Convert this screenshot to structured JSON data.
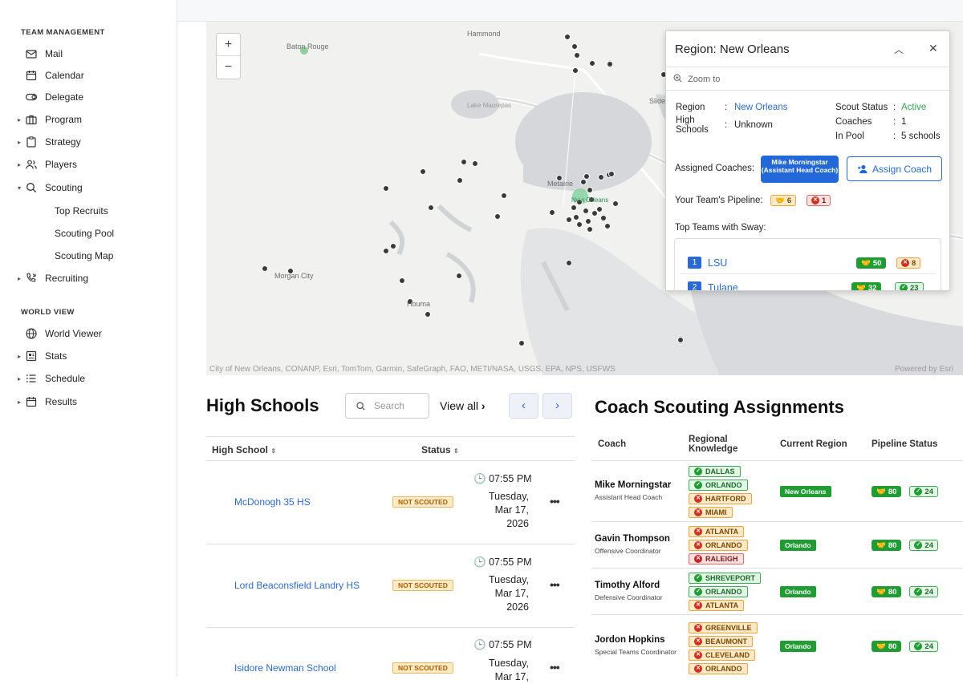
{
  "sidebar": {
    "team_management": "TEAM MANAGEMENT",
    "world_view": "WORLD VIEW",
    "items": [
      {
        "label": "Mail"
      },
      {
        "label": "Calendar"
      },
      {
        "label": "Delegate"
      },
      {
        "label": "Program"
      },
      {
        "label": "Strategy"
      },
      {
        "label": "Players"
      },
      {
        "label": "Scouting"
      },
      {
        "label": "Recruiting"
      },
      {
        "label": "World Viewer"
      },
      {
        "label": "Stats"
      },
      {
        "label": "Schedule"
      },
      {
        "label": "Results"
      }
    ],
    "scouting_sub": [
      "Top Recruits",
      "Scouting Pool",
      "Scouting Map"
    ]
  },
  "map": {
    "zoom_in": "+",
    "zoom_out": "−",
    "places": [
      "Hammond",
      "Baton Rouge",
      "Lake Maurepas",
      "Metairie",
      "New Orleans",
      "Morgan City",
      "Houma",
      "Slidell"
    ],
    "attribution": "City of New Orleans, CONANP, Esri, TomTom, Garmin, SafeGraph, FAO, METI/NASA, USGS, EPA, NPS, USFWS",
    "powered": "Powered by Esri"
  },
  "popup": {
    "title": "Region: New Orleans",
    "zoom_to": "Zoom to",
    "region_label": "Region",
    "region_value": "New Orleans",
    "high_schools_label": "High Schools",
    "high_schools_value": "Unknown",
    "scout_status_label": "Scout Status",
    "scout_status_value": "Active",
    "coaches_label": "Coaches",
    "coaches_value": "1",
    "in_pool_label": "In Pool",
    "in_pool_value": "5 schools",
    "assigned_coaches_label": "Assigned Coaches:",
    "assigned_coach": "Mike Morningstar (Assistant Head Coach)",
    "assign_coach": "Assign Coach",
    "pipeline_label": "Your Team's Pipeline:",
    "pipeline_values": [
      "6",
      "1"
    ],
    "top_teams_label": "Top Teams with Sway:",
    "top_teams": [
      {
        "rank": "1",
        "name": "LSU",
        "a": "50",
        "b": "8"
      },
      {
        "rank": "2",
        "name": "Tulane",
        "a": "32",
        "b": "23"
      }
    ]
  },
  "high_schools": {
    "title": "High Schools",
    "search_placeholder": "Search Hi",
    "view_all": "View all",
    "columns": [
      "High School",
      "Status"
    ],
    "rows": [
      {
        "name": "McDonogh 35 HS",
        "status": "NOT SCOUTED",
        "time": "07:55 PM",
        "date": "Tuesday, Mar 17, 2026"
      },
      {
        "name": "Lord Beaconsfield Landry HS",
        "status": "NOT SCOUTED",
        "time": "07:55 PM",
        "date": "Tuesday, Mar 17, 2026"
      },
      {
        "name": "Isidore Newman School",
        "status": "NOT SCOUTED",
        "time": "07:55 PM",
        "date": "Tuesday, Mar 17,"
      }
    ],
    "more": "•••"
  },
  "assignments": {
    "title": "Coach Scouting Assignments",
    "columns": [
      "Coach",
      "Regional Knowledge",
      "Current Region",
      "Pipeline Status"
    ],
    "rows": [
      {
        "name": "Mike Morningstar",
        "role": "Assistant Head Coach",
        "tags": [
          [
            "DALLAS",
            "g"
          ],
          [
            "ORLANDO",
            "g"
          ],
          [
            "HARTFORD",
            "o"
          ],
          [
            "MIAMI",
            "o"
          ]
        ],
        "region": "New Orleans",
        "p1": "80",
        "p2": "24"
      },
      {
        "name": "Gavin Thompson",
        "role": "Offensive Coordinator",
        "tags": [
          [
            "ATLANTA",
            "o"
          ],
          [
            "ORLANDO",
            "o"
          ],
          [
            "RALEIGH",
            "r"
          ]
        ],
        "region": "Orlando",
        "p1": "80",
        "p2": "24"
      },
      {
        "name": "Timothy Alford",
        "role": "Defensive Coordinator",
        "tags": [
          [
            "SHREVEPORT",
            "g"
          ],
          [
            "ORLANDO",
            "g"
          ],
          [
            "ATLANTA",
            "o"
          ]
        ],
        "region": "Orlando",
        "p1": "80",
        "p2": "24"
      },
      {
        "name": "Jordon Hopkins",
        "role": "Special Teams Coordinator",
        "tags": [
          [
            "GREENVILLE",
            "o"
          ],
          [
            "BEAUMONT",
            "o"
          ],
          [
            "CLEVELAND",
            "o"
          ],
          [
            "ORLANDO",
            "o"
          ]
        ],
        "region": "Orlando",
        "p1": "80",
        "p2": "24"
      }
    ]
  },
  "colors": {
    "accent": "#2368d8",
    "active": "#2fa84f",
    "region_chip": "#1f9d33"
  }
}
